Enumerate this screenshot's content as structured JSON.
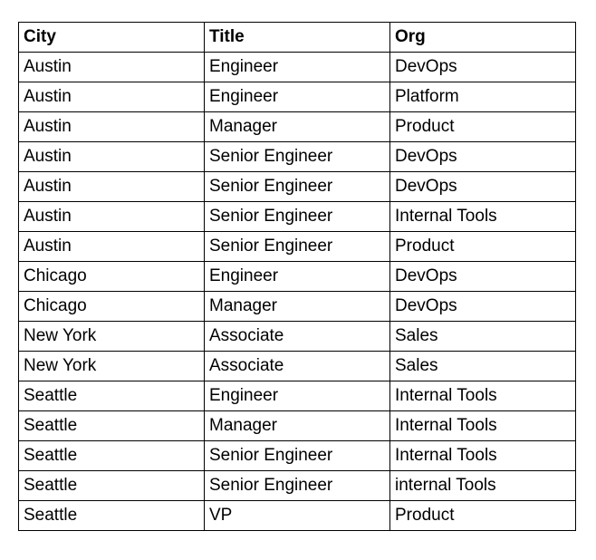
{
  "table": {
    "headers": [
      "City",
      "Title",
      "Org"
    ],
    "rows": [
      [
        "Austin",
        "Engineer",
        "DevOps"
      ],
      [
        "Austin",
        "Engineer",
        "Platform"
      ],
      [
        "Austin",
        "Manager",
        "Product"
      ],
      [
        "Austin",
        "Senior Engineer",
        "DevOps"
      ],
      [
        "Austin",
        "Senior Engineer",
        "DevOps"
      ],
      [
        "Austin",
        "Senior Engineer",
        "Internal Tools"
      ],
      [
        "Austin",
        "Senior Engineer",
        "Product"
      ],
      [
        "Chicago",
        "Engineer",
        "DevOps"
      ],
      [
        "Chicago",
        "Manager",
        "DevOps"
      ],
      [
        "New York",
        "Associate",
        "Sales"
      ],
      [
        "New York",
        "Associate",
        "Sales"
      ],
      [
        "Seattle",
        "Engineer",
        "Internal Tools"
      ],
      [
        "Seattle",
        "Manager",
        "Internal Tools"
      ],
      [
        "Seattle",
        "Senior Engineer",
        "Internal Tools"
      ],
      [
        "Seattle",
        "Senior Engineer",
        "internal Tools"
      ],
      [
        "Seattle",
        "VP",
        "Product"
      ]
    ]
  }
}
